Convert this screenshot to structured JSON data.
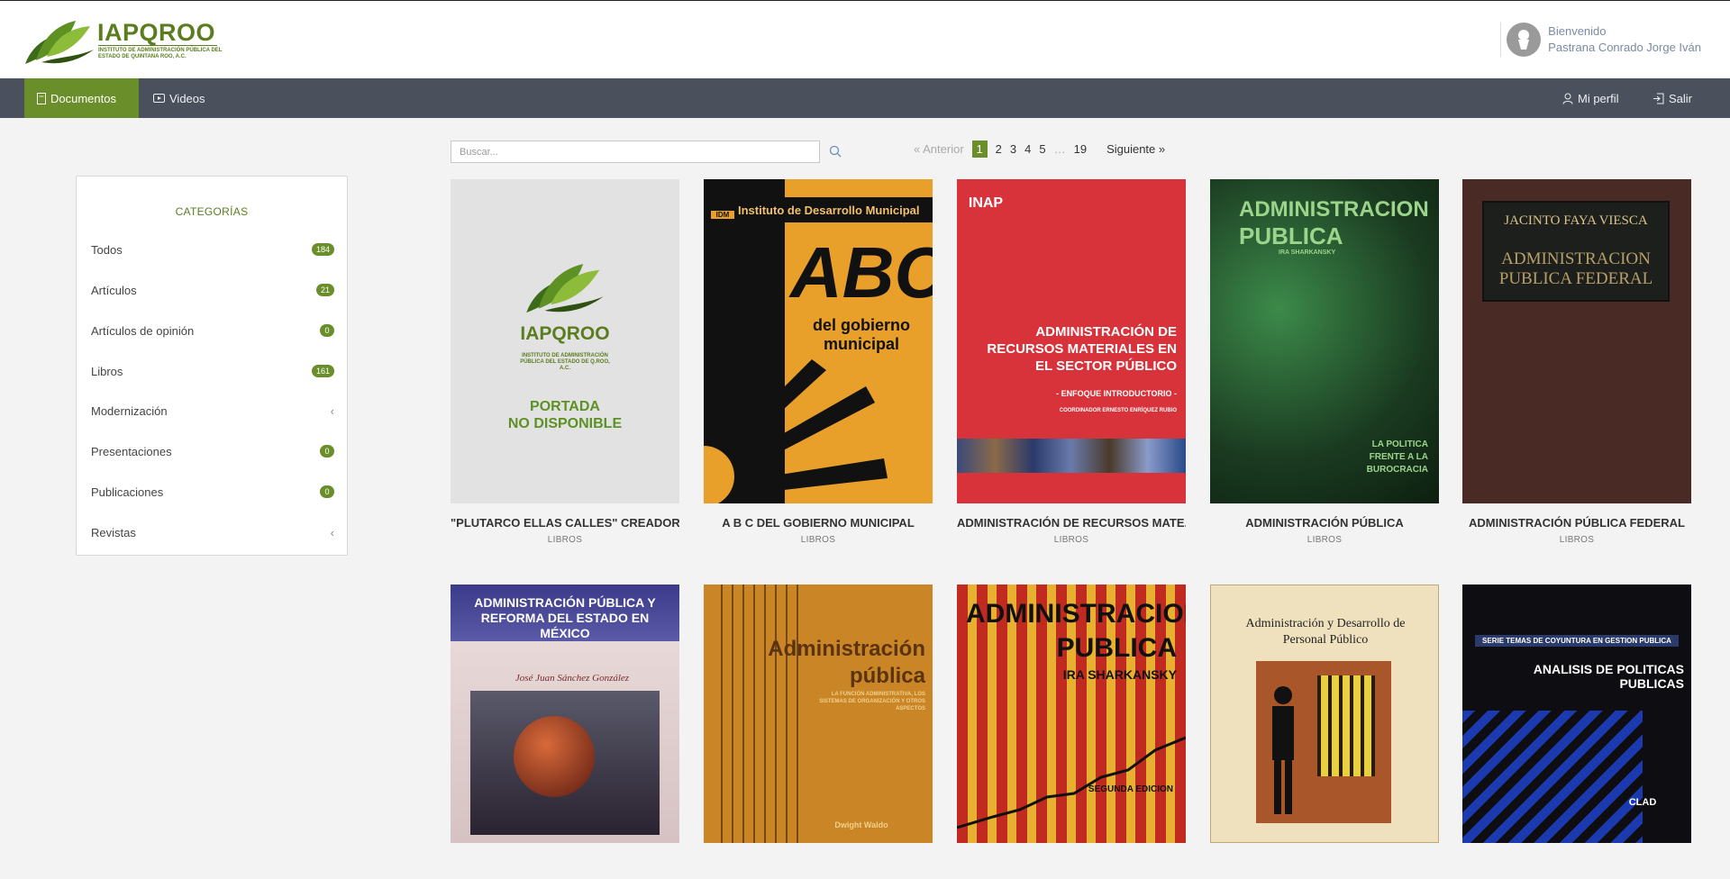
{
  "brand": {
    "name": "IAPQROO",
    "subtitle": "INSTITUTO DE ADMINISTRACIÓN PÚBLICA DEL ESTADO DE QUINTANA ROO, A.C."
  },
  "user": {
    "greeting": "Bienvenido",
    "name": "Pastrana Conrado Jorge Iván"
  },
  "nav": {
    "documents": "Documentos",
    "videos": "Videos",
    "profile": "Mi perfil",
    "logout": "Salir"
  },
  "sidebar": {
    "title": "CATEGORÍAS",
    "items": [
      {
        "label": "Todos",
        "count": "184"
      },
      {
        "label": "Artículos",
        "count": "21"
      },
      {
        "label": "Artículos de opinión",
        "count": "0"
      },
      {
        "label": "Libros",
        "count": "161"
      },
      {
        "label": "Modernización",
        "count": ""
      },
      {
        "label": "Presentaciones",
        "count": "0"
      },
      {
        "label": "Publicaciones",
        "count": "0"
      },
      {
        "label": "Revistas",
        "count": ""
      }
    ]
  },
  "search": {
    "placeholder": "Buscar..."
  },
  "pagination": {
    "prev": "« Anterior",
    "pages": [
      "1",
      "2",
      "3",
      "4",
      "5",
      "…",
      "19"
    ],
    "next": "Siguiente »"
  },
  "books": [
    {
      "title": "\"PLUTARCO ELLAS CALLES\" CREADOR D...",
      "category": "LIBROS",
      "cover": {
        "line1": "IAPQROO",
        "line2": "INSTITUTO DE ADMINISTRACIÓN PÚBLICA DEL ESTADO DE Q.ROO, A.C.",
        "line3": "PORTADA",
        "line4": "NO DISPONIBLE"
      }
    },
    {
      "title": "A B C DEL GOBIERNO MUNICIPAL",
      "category": "LIBROS",
      "cover": {
        "line1": "Instituto de Desarrollo Municipal",
        "line2": "ABC",
        "line3": "del gobierno municipal",
        "line4": "IDM"
      }
    },
    {
      "title": "ADMINISTRACIÓN DE RECURSOS MATE...",
      "category": "LIBROS",
      "cover": {
        "line1": "ADMINISTRACIÓN DE RECURSOS MATERIALES EN EL SECTOR PÚBLICO",
        "line2": "- ENFOQUE INTRODUCTORIO -",
        "line3": "COORDINADOR ERNESTO ENRÍQUEZ RUBIO",
        "line4": "INAP"
      }
    },
    {
      "title": "ADMINISTRACIÓN PÚBLICA",
      "category": "LIBROS",
      "cover": {
        "line1": "ADMINISTRACION",
        "line2": "PUBLICA",
        "line3": "LA POLITICA FRENTE A LA BUROCRACIA",
        "line4": "IRA SHARKANSKY"
      }
    },
    {
      "title": "ADMINISTRACIÓN PÚBLICA FEDERAL",
      "category": "LIBROS",
      "cover": {
        "line1": "JACINTO FAYA VIESCA",
        "line2": "ADMINISTRACION PUBLICA FEDERAL",
        "line3": "",
        "line4": ""
      }
    },
    {
      "title": "",
      "category": "",
      "cover": {
        "line1": "ADMINISTRACIÓN PÚBLICA Y REFORMA DEL ESTADO EN MÉXICO",
        "line2": "José Juan Sánchez González",
        "line3": "",
        "line4": ""
      }
    },
    {
      "title": "",
      "category": "",
      "cover": {
        "line1": "Administración",
        "line2": "pública",
        "line3": "LA FUNCIÓN ADMINISTRATIVA, LOS SISTEMAS DE ORGANIZACIÓN Y OTROS ASPECTOS",
        "line4": "Dwight Waldo"
      }
    },
    {
      "title": "",
      "category": "",
      "cover": {
        "line1": "ADMINISTRACION",
        "line2": "PUBLICA",
        "line3": "IRA SHARKANSKY",
        "line4": "SEGUNDA EDICION"
      }
    },
    {
      "title": "",
      "category": "",
      "cover": {
        "line1": "Administración y Desarrollo de Personal Público",
        "line2": "",
        "line3": "",
        "line4": ""
      }
    },
    {
      "title": "",
      "category": "",
      "cover": {
        "line1": "SERIE TEMAS DE COYUNTURA EN GESTION PUBLICA",
        "line2": "ANALISIS DE POLITICAS PUBLICAS",
        "line3": "CLAD",
        "line4": ""
      }
    }
  ]
}
